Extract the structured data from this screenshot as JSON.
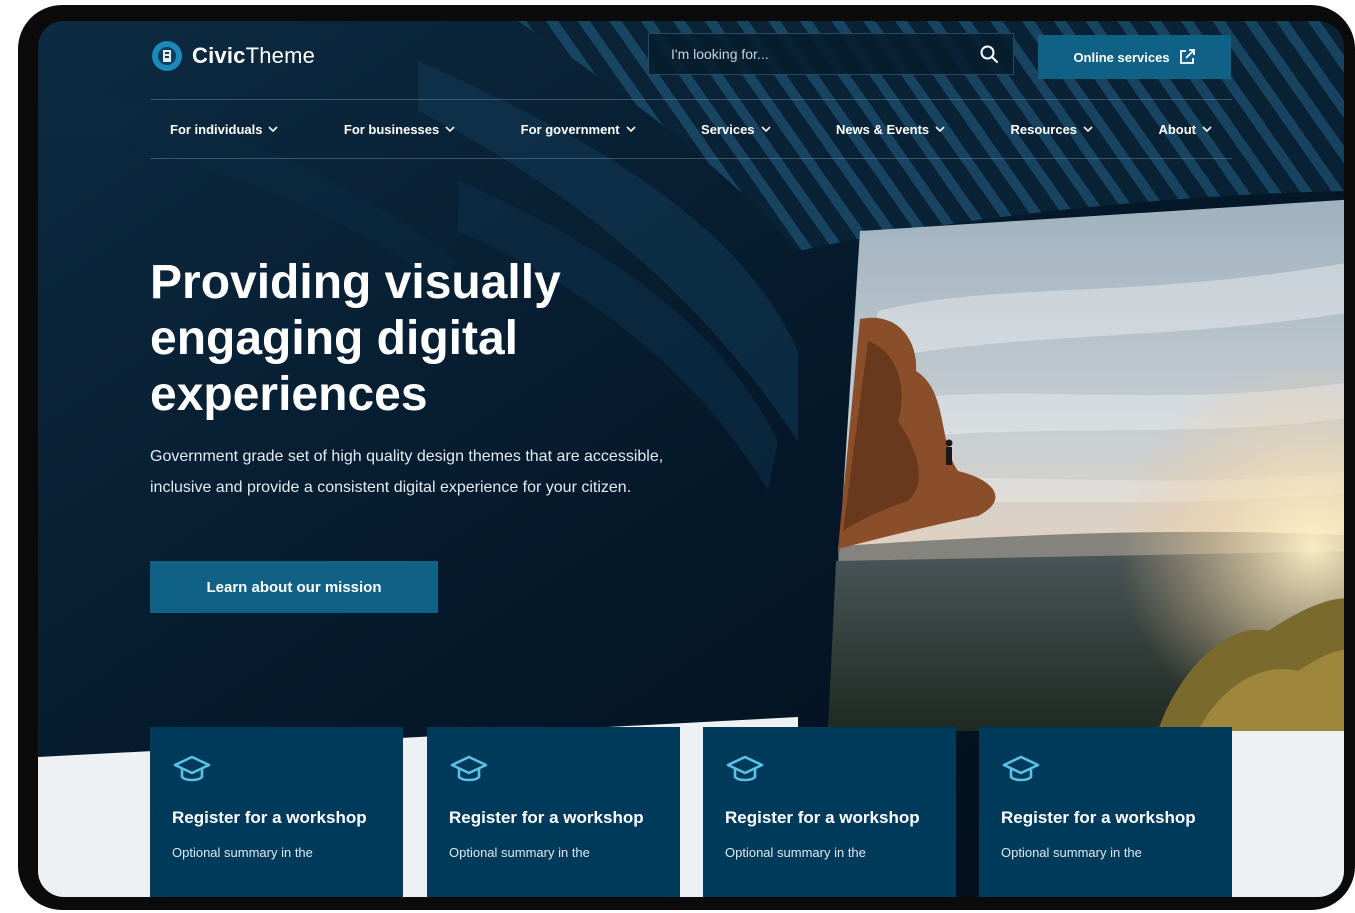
{
  "header": {
    "logo_bold": "Civic",
    "logo_light": "Theme",
    "search_placeholder": "I'm looking for...",
    "online_services_label": "Online services"
  },
  "nav": {
    "items": [
      {
        "label": "For individuals"
      },
      {
        "label": "For businesses"
      },
      {
        "label": "For government"
      },
      {
        "label": "Services"
      },
      {
        "label": "News & Events"
      },
      {
        "label": "Resources"
      },
      {
        "label": "About"
      }
    ]
  },
  "hero": {
    "title": "Providing visually engaging digital experiences",
    "description": "Government grade set of high quality design themes that are accessible, inclusive and provide a consistent digital experience for your citizen.",
    "cta_label": "Learn about our mission"
  },
  "cards": [
    {
      "title": "Register for a workshop",
      "summary": "Optional summary in the"
    },
    {
      "title": "Register for a workshop",
      "summary": "Optional summary in the"
    },
    {
      "title": "Register for a workshop",
      "summary": "Optional summary in the"
    },
    {
      "title": "Register for a workshop",
      "summary": "Optional summary in the"
    }
  ],
  "colors": {
    "primary_dark": "#031322",
    "accent_blue": "#0f6186",
    "card_bg": "#003a5b",
    "icon_accent": "#5ac2e4"
  },
  "icons": {
    "logo": "civictheme-logo-icon",
    "search": "search-icon",
    "external": "external-link-icon",
    "nav_caret": "chevron-down-icon",
    "card": "graduation-cap-icon"
  }
}
